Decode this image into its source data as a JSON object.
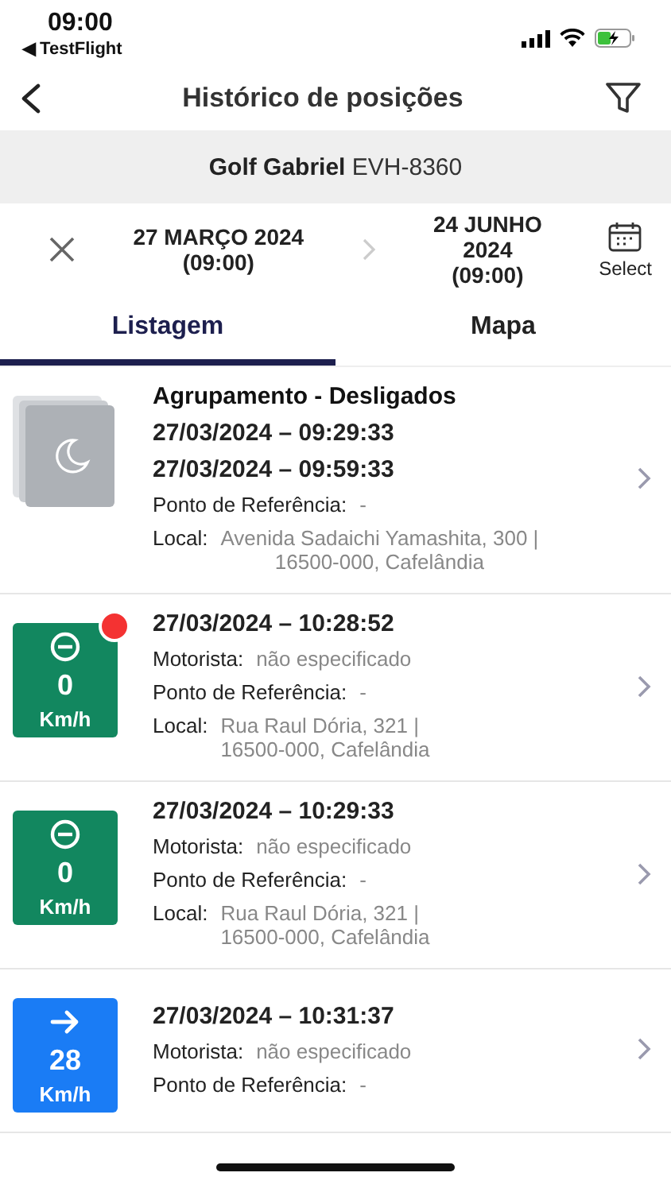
{
  "status_bar": {
    "time": "09:00",
    "back_app": "◀ TestFlight"
  },
  "header": {
    "title": "Histórico de posições"
  },
  "vehicle": {
    "name": "Golf Gabriel",
    "plate": "EVH-8360"
  },
  "date_range": {
    "start": [
      "27 MARÇO 2024",
      "(09:00)"
    ],
    "end": [
      "24 JUNHO",
      "2024",
      "(09:00)"
    ],
    "select_label": "Select"
  },
  "tabs": [
    {
      "label": "Listagem",
      "selected": true
    },
    {
      "label": "Mapa",
      "selected": false
    }
  ],
  "items": [
    {
      "kind": "group",
      "title": "Agrupamento - Desligados",
      "datetimes": [
        "27/03/2024 – 09:29:33",
        "27/03/2024 – 09:59:33"
      ],
      "fields": [
        {
          "label": "Ponto de Referência:",
          "value": [
            "-"
          ]
        },
        {
          "label": "Local:",
          "value": [
            "Avenida Sadaichi Yamashita, 300 |",
            "16500-000, Cafelândia"
          ]
        }
      ]
    },
    {
      "kind": "stopped",
      "color": "#12875f",
      "speed": "0",
      "unit": "Km/h",
      "alert": true,
      "datetimes": [
        "27/03/2024 – 10:28:52"
      ],
      "fields": [
        {
          "label": "Motorista:",
          "value": [
            "não especificado"
          ]
        },
        {
          "label": "Ponto de Referência:",
          "value": [
            "-"
          ]
        },
        {
          "label": "Local:",
          "value": [
            "Rua Raul Dória, 321 |",
            "16500-000, Cafelândia"
          ]
        }
      ]
    },
    {
      "kind": "stopped",
      "color": "#12875f",
      "speed": "0",
      "unit": "Km/h",
      "alert": false,
      "datetimes": [
        "27/03/2024 – 10:29:33"
      ],
      "fields": [
        {
          "label": "Motorista:",
          "value": [
            "não especificado"
          ]
        },
        {
          "label": "Ponto de Referência:",
          "value": [
            "-"
          ]
        },
        {
          "label": "Local:",
          "value": [
            "Rua Raul Dória, 321 |",
            "16500-000, Cafelândia"
          ]
        }
      ]
    },
    {
      "kind": "moving",
      "color": "#1a7cf5",
      "speed": "28",
      "unit": "Km/h",
      "alert": false,
      "datetimes": [
        "27/03/2024 – 10:31:37"
      ],
      "fields": [
        {
          "label": "Motorista:",
          "value": [
            "não especificado"
          ]
        },
        {
          "label": "Ponto de Referência:",
          "value": [
            "-"
          ]
        }
      ]
    }
  ]
}
